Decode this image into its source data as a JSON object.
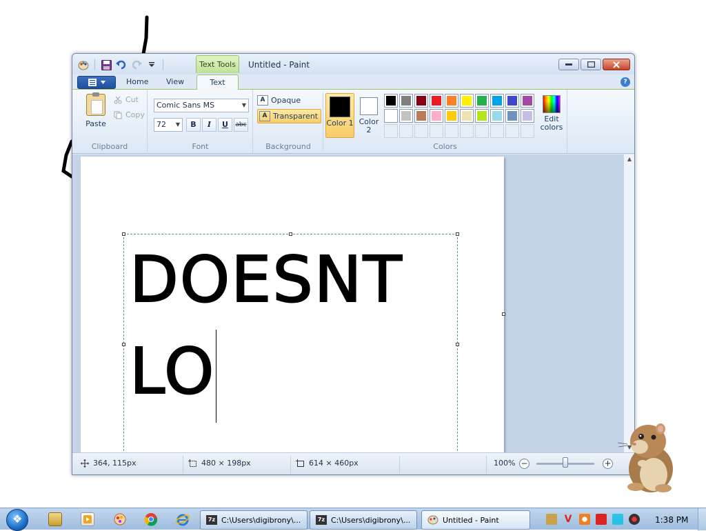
{
  "window": {
    "title": "Untitled - Paint",
    "contextual_tab": "Text Tools"
  },
  "ribbon": {
    "tabs": [
      "Home",
      "View",
      "Text"
    ],
    "active_tab": "Text",
    "clipboard": {
      "paste": "Paste",
      "cut": "Cut",
      "copy": "Copy",
      "label": "Clipboard"
    },
    "font": {
      "family": "Comic Sans MS",
      "size": "72",
      "bold": "B",
      "italic": "I",
      "underline": "U",
      "strikethrough": "abc",
      "label": "Font"
    },
    "background": {
      "opaque": "Opaque",
      "transparent": "Transparent",
      "selected": "Transparent",
      "label": "Background"
    },
    "colors": {
      "color1_label": "Color 1",
      "color2_label": "Color 2",
      "color1_value": "#000000",
      "color2_value": "#ffffff",
      "palette_row1": [
        "#000000",
        "#7f7f7f",
        "#880015",
        "#ed1c24",
        "#ff7f27",
        "#fff200",
        "#22b14c",
        "#00a2e8",
        "#3f48cc",
        "#a349a4"
      ],
      "palette_row2": [
        "#ffffff",
        "#c3c3c3",
        "#b97a57",
        "#ffaec9",
        "#ffc90e",
        "#efe4b0",
        "#b5e61d",
        "#99d9ea",
        "#7092be",
        "#c8bfe7"
      ],
      "palette_row3_empty": 10,
      "edit_colors": "Edit colors",
      "label": "Colors"
    }
  },
  "canvas": {
    "line1": "DOESNT",
    "line2": "LO"
  },
  "status": {
    "cursor_pos": "364, 115px",
    "selection_size": "480 × 198px",
    "image_size": "614 × 460px",
    "zoom": "100%",
    "zoom_fraction": 0.5
  },
  "taskbar": {
    "buttons": [
      "C:\\Users\\digibrony\\...",
      "C:\\Users\\digibrony\\...",
      "Untitled - Paint"
    ],
    "clock": "1:38 PM"
  }
}
